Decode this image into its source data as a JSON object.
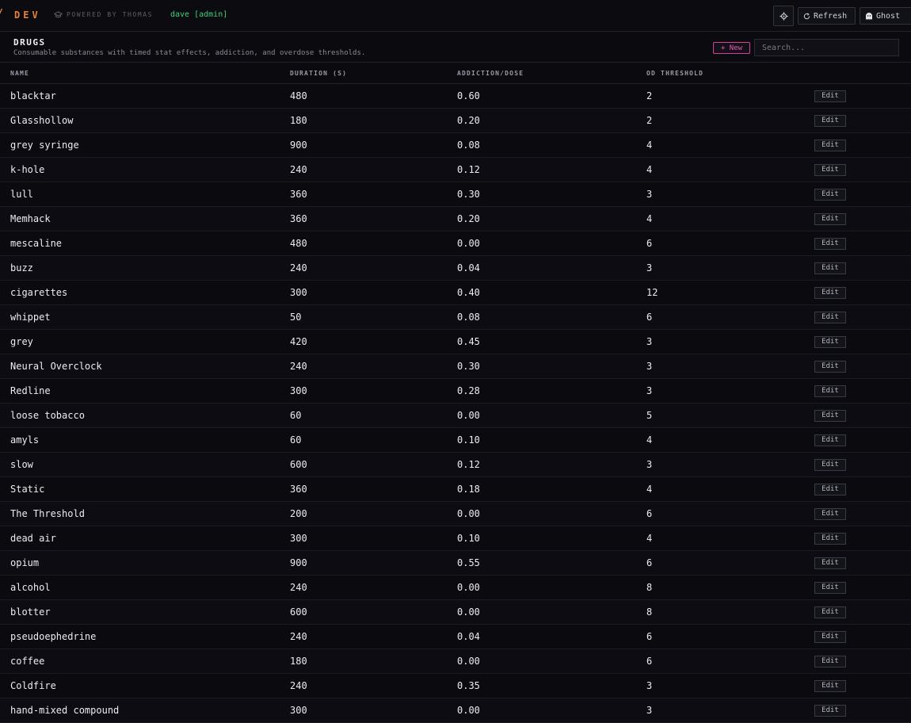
{
  "topbar": {
    "brand_mark": "/",
    "brand": "DEV",
    "powered_by": "POWERED BY THOMAS",
    "user": "dave [admin]",
    "refresh_label": "Refresh",
    "ghost_label": "Ghost"
  },
  "panel": {
    "title": "DRUGS",
    "subtitle": "Consumable substances with timed stat effects, addiction, and overdose thresholds.",
    "new_label": "+ New",
    "search_placeholder": "Search..."
  },
  "table": {
    "columns": [
      "NAME",
      "DURATION (S)",
      "ADDICTION/DOSE",
      "OD THRESHOLD"
    ],
    "edit_label": "Edit",
    "rows": [
      {
        "name": "blacktar",
        "duration": "480",
        "addiction": "0.60",
        "od": "2"
      },
      {
        "name": "Glasshollow",
        "duration": "180",
        "addiction": "0.20",
        "od": "2"
      },
      {
        "name": "grey syringe",
        "duration": "900",
        "addiction": "0.08",
        "od": "4"
      },
      {
        "name": "k-hole",
        "duration": "240",
        "addiction": "0.12",
        "od": "4"
      },
      {
        "name": "lull",
        "duration": "360",
        "addiction": "0.30",
        "od": "3"
      },
      {
        "name": "Memhack",
        "duration": "360",
        "addiction": "0.20",
        "od": "4"
      },
      {
        "name": "mescaline",
        "duration": "480",
        "addiction": "0.00",
        "od": "6"
      },
      {
        "name": "buzz",
        "duration": "240",
        "addiction": "0.04",
        "od": "3"
      },
      {
        "name": "cigarettes",
        "duration": "300",
        "addiction": "0.40",
        "od": "12"
      },
      {
        "name": "whippet",
        "duration": "50",
        "addiction": "0.08",
        "od": "6"
      },
      {
        "name": "grey",
        "duration": "420",
        "addiction": "0.45",
        "od": "3"
      },
      {
        "name": "Neural Overclock",
        "duration": "240",
        "addiction": "0.30",
        "od": "3"
      },
      {
        "name": "Redline",
        "duration": "300",
        "addiction": "0.28",
        "od": "3"
      },
      {
        "name": "loose tobacco",
        "duration": "60",
        "addiction": "0.00",
        "od": "5"
      },
      {
        "name": "amyls",
        "duration": "60",
        "addiction": "0.10",
        "od": "4"
      },
      {
        "name": "slow",
        "duration": "600",
        "addiction": "0.12",
        "od": "3"
      },
      {
        "name": "Static",
        "duration": "360",
        "addiction": "0.18",
        "od": "4"
      },
      {
        "name": "The Threshold",
        "duration": "200",
        "addiction": "0.00",
        "od": "6"
      },
      {
        "name": "dead air",
        "duration": "300",
        "addiction": "0.10",
        "od": "4"
      },
      {
        "name": "opium",
        "duration": "900",
        "addiction": "0.55",
        "od": "6"
      },
      {
        "name": "alcohol",
        "duration": "240",
        "addiction": "0.00",
        "od": "8"
      },
      {
        "name": "blotter",
        "duration": "600",
        "addiction": "0.00",
        "od": "8"
      },
      {
        "name": "pseudoephedrine",
        "duration": "240",
        "addiction": "0.04",
        "od": "6"
      },
      {
        "name": "coffee",
        "duration": "180",
        "addiction": "0.00",
        "od": "6"
      },
      {
        "name": "Coldfire",
        "duration": "240",
        "addiction": "0.35",
        "od": "3"
      },
      {
        "name": "hand-mixed compound",
        "duration": "300",
        "addiction": "0.00",
        "od": "3"
      }
    ]
  }
}
